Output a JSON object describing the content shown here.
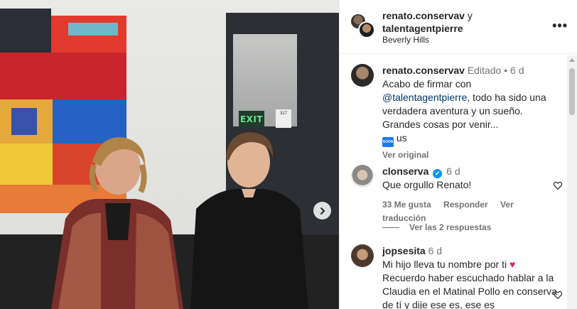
{
  "post": {
    "authors": {
      "primary": "renato.conservav",
      "joiner": "y",
      "secondary": "talentagentpierre"
    },
    "location": "Beverly Hills",
    "more_label": "•••"
  },
  "photo": {
    "exit_sign": "EXIT",
    "next_icon": "chevron-right-icon"
  },
  "comments": [
    {
      "user": "renato.conservav",
      "edited": "Editado",
      "dot": "•",
      "time": "6 d",
      "text_before": "Acabo de firmar con",
      "mention": "@talentagentpierre",
      "text_after": ", todo ha sido una verdadera aventura y un sueño. Grandes cosas por venir...",
      "emoji_label": "SOON",
      "text_tail": "us",
      "see_original": "Ver original"
    },
    {
      "user": "clonserva",
      "verified": "✔",
      "time": "6 d",
      "text": "Que orgullo Renato!",
      "likes": "33 Me gusta",
      "reply": "Responder",
      "translate": "Ver traducción",
      "view_replies": "Ver las 2 respuestas"
    },
    {
      "user": "jopsesita",
      "time": "6 d",
      "text": "Mi hijo lleva tu nombre por ti",
      "heart_emoji": "♥",
      "text2": "Recuerdo haber escuchado hablar a la Claudia en el Matinal Pollo en conserva de tí y dije ese es, ese es"
    }
  ],
  "colors": {
    "accent_blue": "#0095f6",
    "link": "#00376b",
    "muted": "#737373",
    "text": "#262626"
  }
}
